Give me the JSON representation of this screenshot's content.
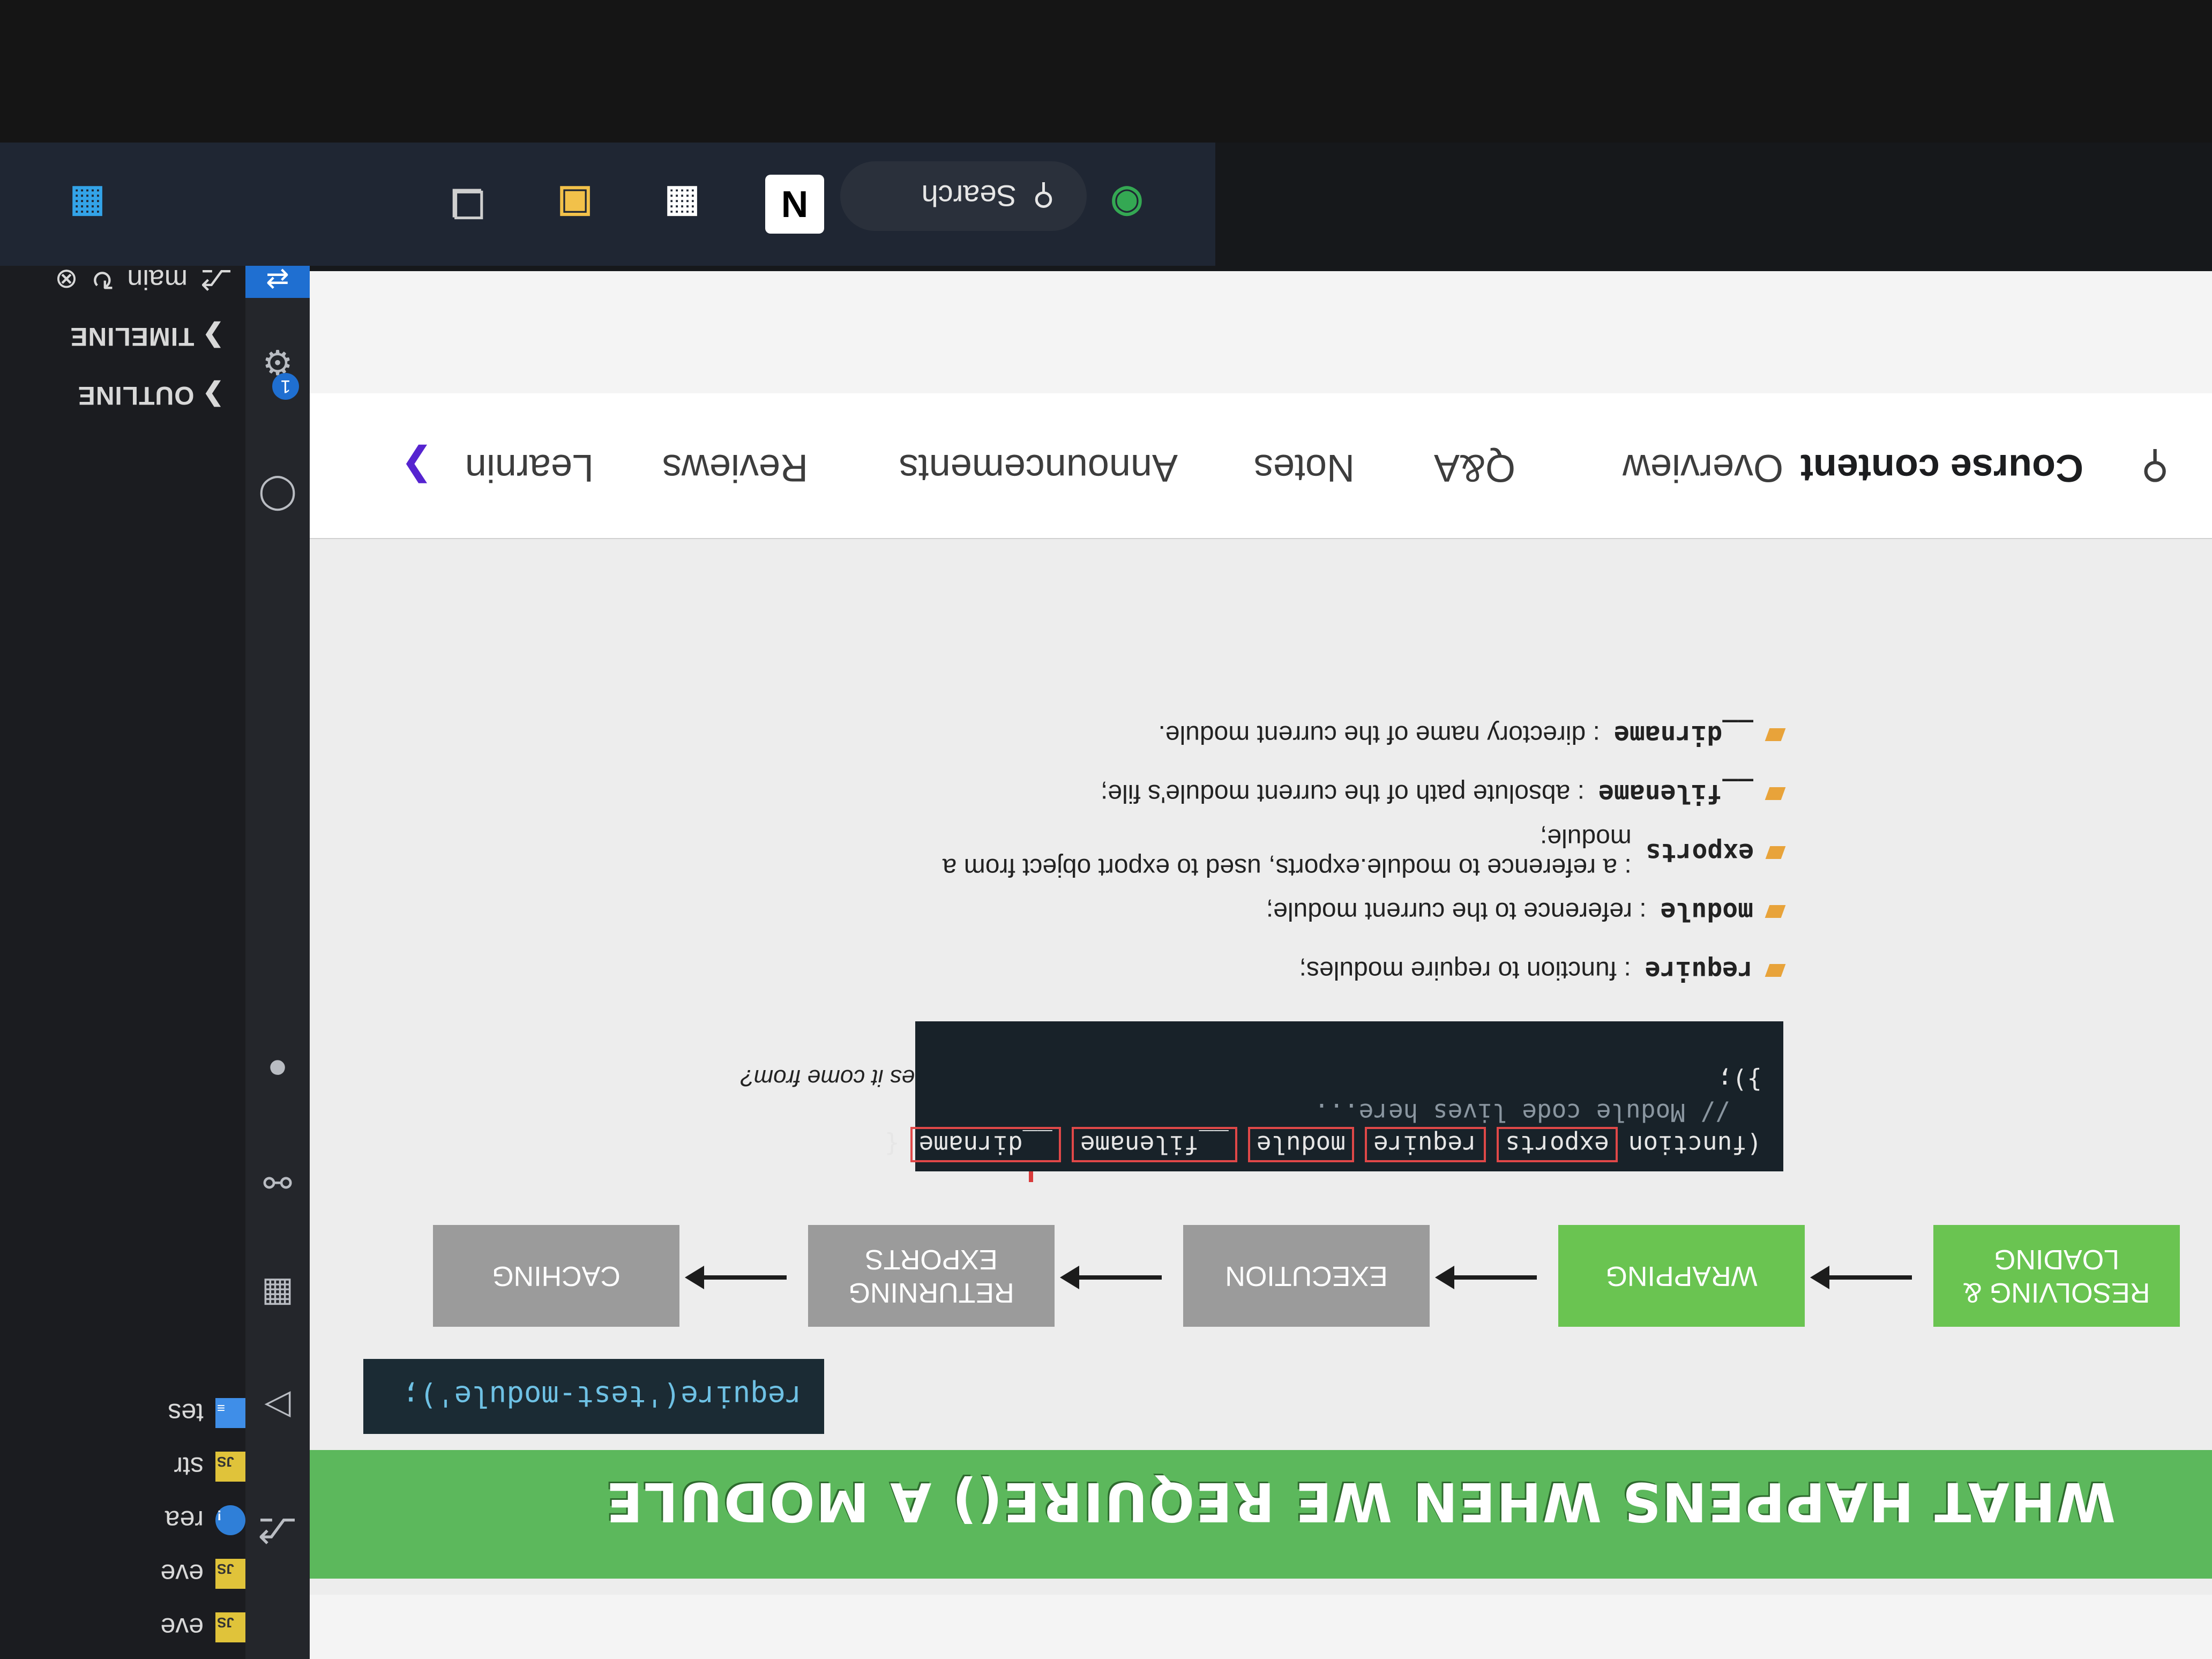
{
  "taskbar": {
    "search_label": "Search",
    "icons": [
      "windows-start-icon",
      "task-view-icon",
      "file-explorer-icon",
      "microsoft-store-icon",
      "notion-icon",
      "vscode-icon",
      "chrome-icon",
      "chrome-profile-icon"
    ]
  },
  "vscode": {
    "explorer": {
      "files": [
        {
          "badge": "JS",
          "name": "eve"
        },
        {
          "badge": "JS",
          "name": "eve"
        },
        {
          "badge": "!",
          "name": "rea"
        },
        {
          "badge": "JS",
          "name": "str"
        },
        {
          "badge": "≡",
          "name": "tes"
        }
      ],
      "outline_label": "OUTLINE",
      "timeline_label": "TIMELINE"
    },
    "settings_badge": "1",
    "status": {
      "branch": "main"
    }
  },
  "course": {
    "tabs": [
      "Course content",
      "Overview",
      "Q&A",
      "Notes",
      "Announcements",
      "Reviews",
      "Learnin"
    ],
    "slide": {
      "title": "WHAT HAPPENS WHEN WE REQUIRE() A MODULE",
      "require_code": "require('test-module');",
      "steps": [
        "RESOLVING & LOADING",
        "WRAPPING",
        "EXECUTION",
        "RETURNING EXPORTS",
        "CACHING"
      ],
      "callout": "Where does it come from?",
      "code": {
        "line1_start": "(function",
        "params": [
          "exports",
          "require",
          "module",
          "__filename",
          "__dirname"
        ],
        "line1_end": "{",
        "line2": "// Module code lives here...",
        "line3": "});"
      },
      "bullets": [
        {
          "term": "require",
          "text": ": function to require modules;"
        },
        {
          "term": "module",
          "text": ": reference to the current module;"
        },
        {
          "term": "exports",
          "text": ": a reference to module.exports, used to export object from a module;"
        },
        {
          "term": "__filename",
          "text": ": absolute path of the current module's file;"
        },
        {
          "term": "__dirname",
          "text": ": directory name of the current module."
        }
      ]
    }
  }
}
